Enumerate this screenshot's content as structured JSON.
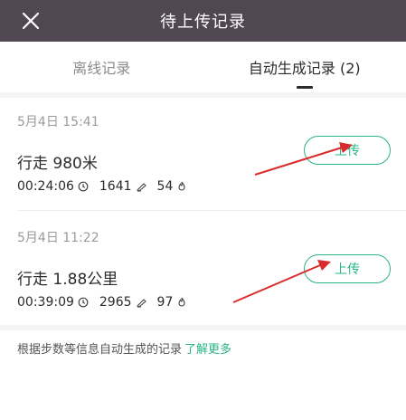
{
  "header": {
    "title": "待上传记录",
    "close_icon": "close-icon"
  },
  "tabs": [
    {
      "label": "离线记录",
      "active": false
    },
    {
      "label": "自动生成记录 (2)",
      "active": true
    }
  ],
  "records": [
    {
      "date": "5月4日 15:41",
      "activity": "行走 980米",
      "duration": "00:24:06",
      "steps": "1641",
      "calories": "54",
      "upload_label": "上传"
    },
    {
      "date": "5月4日 11:22",
      "activity": "行走 1.88公里",
      "duration": "00:39:09",
      "steps": "2965",
      "calories": "97",
      "upload_label": "上传"
    }
  ],
  "footer": {
    "note": "根据步数等信息自动生成的记录",
    "link": "了解更多"
  },
  "colors": {
    "header_bg": "#504752",
    "accent": "#29b584",
    "annotation_arrow": "#d92b2b"
  }
}
